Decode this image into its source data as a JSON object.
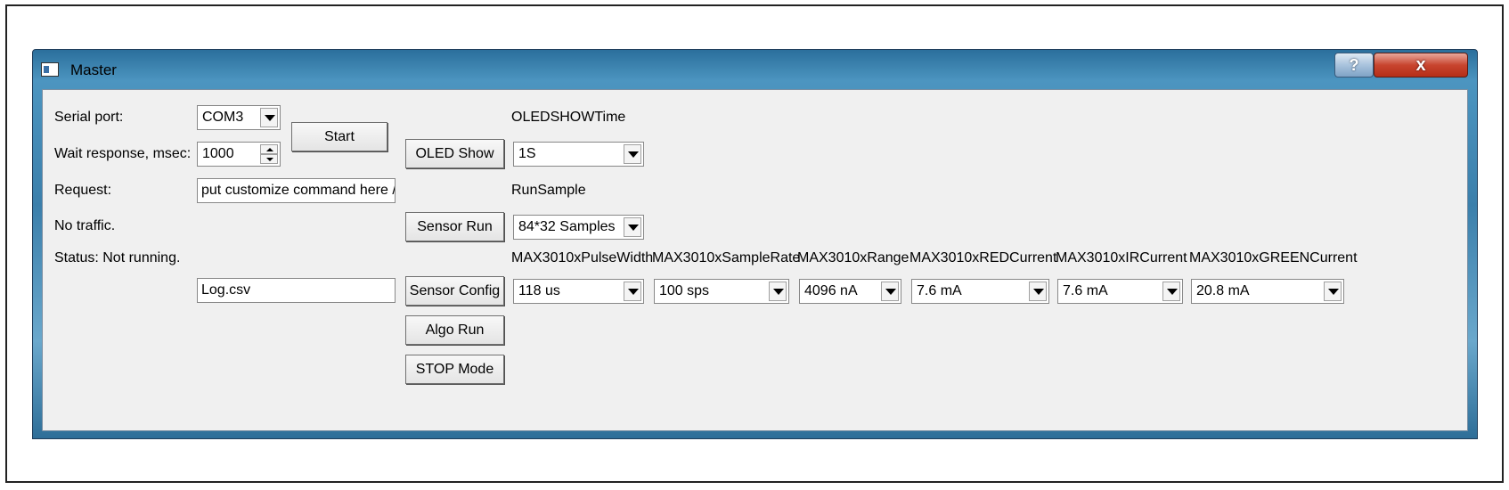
{
  "window": {
    "title": "Master",
    "help_label": "?",
    "close_label": "x"
  },
  "serial": {
    "port_label": "Serial port:",
    "port_value": "COM3",
    "wait_label": "Wait response, msec:",
    "wait_value": "1000",
    "start_label": "Start",
    "request_label": "Request:",
    "request_value": "put customize command here //",
    "traffic_text": "No traffic.",
    "status_text": "Status: Not running.",
    "log_value": "Log.csv"
  },
  "buttons": {
    "oled_show": "OLED Show",
    "sensor_run": "Sensor Run",
    "sensor_config": "Sensor Config",
    "algo_run": "Algo Run",
    "stop_mode": "STOP Mode"
  },
  "oled": {
    "label": "OLEDSHOWTime",
    "value": "1S"
  },
  "run_sample": {
    "label": "RunSample",
    "value": "84*32 Samples"
  },
  "sensor_config": {
    "pulse_width": {
      "label": "MAX3010xPulseWidth",
      "value": "118 us"
    },
    "sample_rate": {
      "label": "MAX3010xSampleRate",
      "value": "100 sps"
    },
    "range": {
      "label": "MAX3010xRange",
      "value": "4096 nA"
    },
    "red_current": {
      "label": "MAX3010xREDCurrent",
      "value": "7.6 mA"
    },
    "ir_current": {
      "label": "MAX3010xIRCurrent",
      "value": "7.6 mA"
    },
    "green_current": {
      "label": "MAX3010xGREENCurrent",
      "value": "20.8 mA"
    }
  }
}
